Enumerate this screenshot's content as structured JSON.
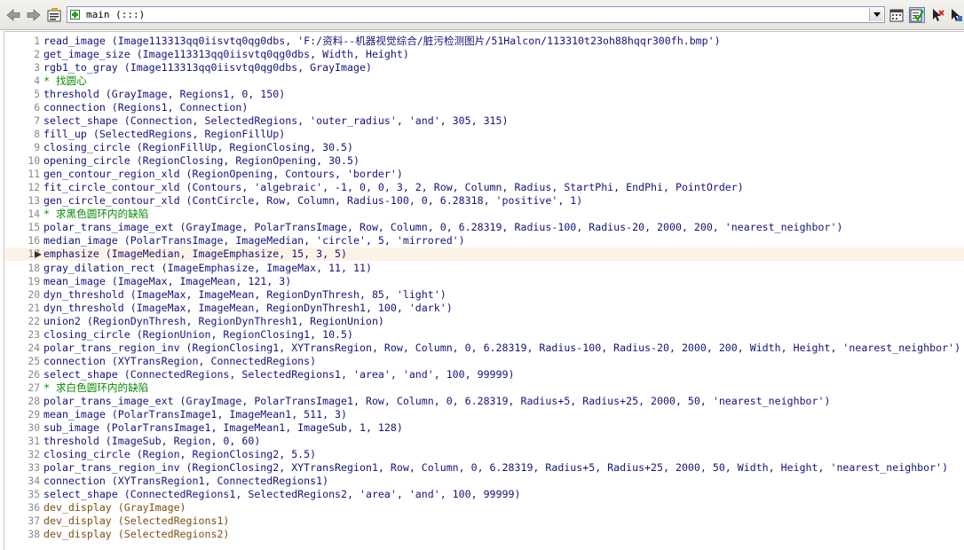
{
  "editor": {
    "procedure": "main (:::)",
    "lines": [
      {
        "n": "1",
        "text": "read_image (Image113313qq0iisvtq0qg0dbs, 'F:/资料--机器视觉综合/脏污检测图片/51Halcon/113310t23oh88hqqr300fh.bmp')",
        "kind": "op"
      },
      {
        "n": "2",
        "text": "get_image_size (Image113313qq0iisvtq0qg0dbs, Width, Height)",
        "kind": "op"
      },
      {
        "n": "3",
        "text": "rgb1_to_gray (Image113313qq0iisvtq0qg0dbs, GrayImage)",
        "kind": "op"
      },
      {
        "n": "4",
        "text": "* 找圆心",
        "kind": "comment"
      },
      {
        "n": "5",
        "text": "threshold (GrayImage, Regions1, 0, 150)",
        "kind": "op"
      },
      {
        "n": "6",
        "text": "connection (Regions1, Connection)",
        "kind": "op"
      },
      {
        "n": "7",
        "text": "select_shape (Connection, SelectedRegions, 'outer_radius', 'and', 305, 315)",
        "kind": "op"
      },
      {
        "n": "8",
        "text": "fill_up (SelectedRegions, RegionFillUp)",
        "kind": "op"
      },
      {
        "n": "9",
        "text": "closing_circle (RegionFillUp, RegionClosing, 30.5)",
        "kind": "op"
      },
      {
        "n": "10",
        "text": "opening_circle (RegionClosing, RegionOpening, 30.5)",
        "kind": "op"
      },
      {
        "n": "11",
        "text": "gen_contour_region_xld (RegionOpening, Contours, 'border')",
        "kind": "op"
      },
      {
        "n": "12",
        "text": "fit_circle_contour_xld (Contours, 'algebraic', -1, 0, 0, 3, 2, Row, Column, Radius, StartPhi, EndPhi, PointOrder)",
        "kind": "op"
      },
      {
        "n": "13",
        "text": "gen_circle_contour_xld (ContCircle, Row, Column, Radius-100, 0, 6.28318, 'positive', 1)",
        "kind": "op"
      },
      {
        "n": "14",
        "text": "* 求黑色圆环内的缺陷",
        "kind": "comment"
      },
      {
        "n": "15",
        "text": "polar_trans_image_ext (GrayImage, PolarTransImage, Row, Column, 0, 6.28319, Radius-100, Radius-20, 2000, 200, 'nearest_neighbor')",
        "kind": "op"
      },
      {
        "n": "16",
        "text": "median_image (PolarTransImage, ImageMedian, 'circle', 5, 'mirrored')",
        "kind": "op"
      },
      {
        "n": "17",
        "text": "emphasize (ImageMedian, ImageEmphasize, 15, 3, 5)",
        "kind": "op",
        "highlight": true
      },
      {
        "n": "18",
        "text": "gray_dilation_rect (ImageEmphasize, ImageMax, 11, 11)",
        "kind": "op"
      },
      {
        "n": "19",
        "text": "mean_image (ImageMax, ImageMean, 121, 3)",
        "kind": "op"
      },
      {
        "n": "20",
        "text": "dyn_threshold (ImageMax, ImageMean, RegionDynThresh, 85, 'light')",
        "kind": "op"
      },
      {
        "n": "21",
        "text": "dyn_threshold (ImageMax, ImageMean, RegionDynThresh1, 100, 'dark')",
        "kind": "op"
      },
      {
        "n": "22",
        "text": "union2 (RegionDynThresh, RegionDynThresh1, RegionUnion)",
        "kind": "op"
      },
      {
        "n": "23",
        "text": "closing_circle (RegionUnion, RegionClosing1, 10.5)",
        "kind": "op"
      },
      {
        "n": "24",
        "text": "polar_trans_region_inv (RegionClosing1, XYTransRegion, Row, Column, 0, 6.28319, Radius-100, Radius-20, 2000, 200, Width, Height, 'nearest_neighbor')",
        "kind": "op"
      },
      {
        "n": "25",
        "text": "connection (XYTransRegion, ConnectedRegions)",
        "kind": "op"
      },
      {
        "n": "26",
        "text": "select_shape (ConnectedRegions, SelectedRegions1, 'area', 'and', 100, 99999)",
        "kind": "op"
      },
      {
        "n": "27",
        "text": "* 求白色圆环内的缺陷",
        "kind": "comment"
      },
      {
        "n": "28",
        "text": "polar_trans_image_ext (GrayImage, PolarTransImage1, Row, Column, 0, 6.28319, Radius+5, Radius+25, 2000, 50, 'nearest_neighbor')",
        "kind": "op"
      },
      {
        "n": "29",
        "text": "mean_image (PolarTransImage1, ImageMean1, 511, 3)",
        "kind": "op"
      },
      {
        "n": "30",
        "text": "sub_image (PolarTransImage1, ImageMean1, ImageSub, 1, 128)",
        "kind": "op"
      },
      {
        "n": "31",
        "text": "threshold (ImageSub, Region, 0, 60)",
        "kind": "op"
      },
      {
        "n": "32",
        "text": "closing_circle (Region, RegionClosing2, 5.5)",
        "kind": "op"
      },
      {
        "n": "33",
        "text": "polar_trans_region_inv (RegionClosing2, XYTransRegion1, Row, Column, 0, 6.28319, Radius+5, Radius+25, 2000, 50, Width, Height, 'nearest_neighbor')",
        "kind": "op"
      },
      {
        "n": "34",
        "text": "connection (XYTransRegion1, ConnectedRegions1)",
        "kind": "op"
      },
      {
        "n": "35",
        "text": "select_shape (ConnectedRegions1, SelectedRegions2, 'area', 'and', 100, 99999)",
        "kind": "op"
      },
      {
        "n": "36",
        "text": "dev_display (GrayImage)",
        "kind": "disp"
      },
      {
        "n": "37",
        "text": "dev_display (SelectedRegions1)",
        "kind": "disp"
      },
      {
        "n": "38",
        "text": "dev_display (SelectedRegions2)",
        "kind": "disp"
      }
    ]
  },
  "icons": {
    "back": "arrow-left-icon",
    "forward": "arrow-right-icon",
    "procedure": "procedure-list-icon",
    "proc_entry": "procedure-icon",
    "dropdown": "chevron-down-icon",
    "t1": "calendar-icon",
    "t2": "check-icon",
    "t3": "cursor-run-icon",
    "t4": "export-icon"
  }
}
